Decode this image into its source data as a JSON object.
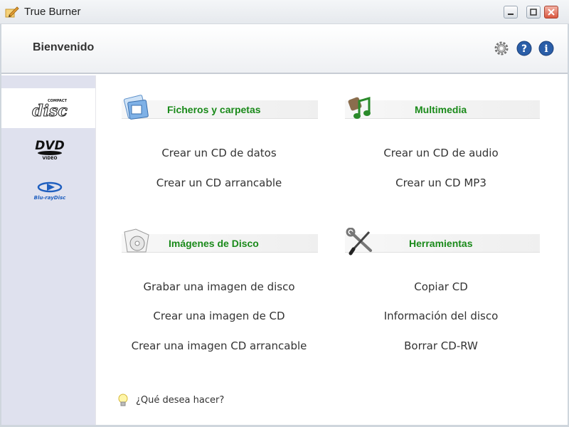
{
  "window": {
    "title": "True Burner",
    "buttons": {
      "minimize": "minimize-icon",
      "maximize": "maximize-icon",
      "close": "close-icon"
    }
  },
  "header": {
    "title": "Bienvenido",
    "icons": [
      "gear-icon",
      "help-icon",
      "info-icon"
    ]
  },
  "sidebar": {
    "items": [
      {
        "name": "compact-disc-logo-icon",
        "active": true
      },
      {
        "name": "dvd-video-logo-icon",
        "active": false
      },
      {
        "name": "blu-ray-disc-logo-icon",
        "active": false
      }
    ]
  },
  "sections": {
    "files": {
      "title": "Ficheros y carpetas",
      "icon": "files-folders-icon",
      "links": [
        "Crear un CD de datos",
        "Crear un CD arrancable"
      ]
    },
    "multimedia": {
      "title": "Multimedia",
      "icon": "music-note-icon",
      "links": [
        "Crear un CD de audio",
        "Crear un CD MP3"
      ]
    },
    "images": {
      "title": "Imágenes de Disco",
      "icon": "disc-image-icon",
      "links": [
        "Grabar una imagen de disco",
        "Crear una imagen de CD",
        "Crear una imagen CD arrancable"
      ]
    },
    "tools": {
      "title": "Herramientas",
      "icon": "tools-icon",
      "links": [
        "Copiar CD",
        "Información del disco",
        "Borrar CD-RW"
      ]
    }
  },
  "footer": {
    "text": "¿Qué desea hacer?",
    "icon": "light-bulb-icon"
  },
  "colors": {
    "section_title": "#1a8a1a",
    "sidebar_bg": "#dfe1ee",
    "accent_blue": "#2a5ea8"
  }
}
